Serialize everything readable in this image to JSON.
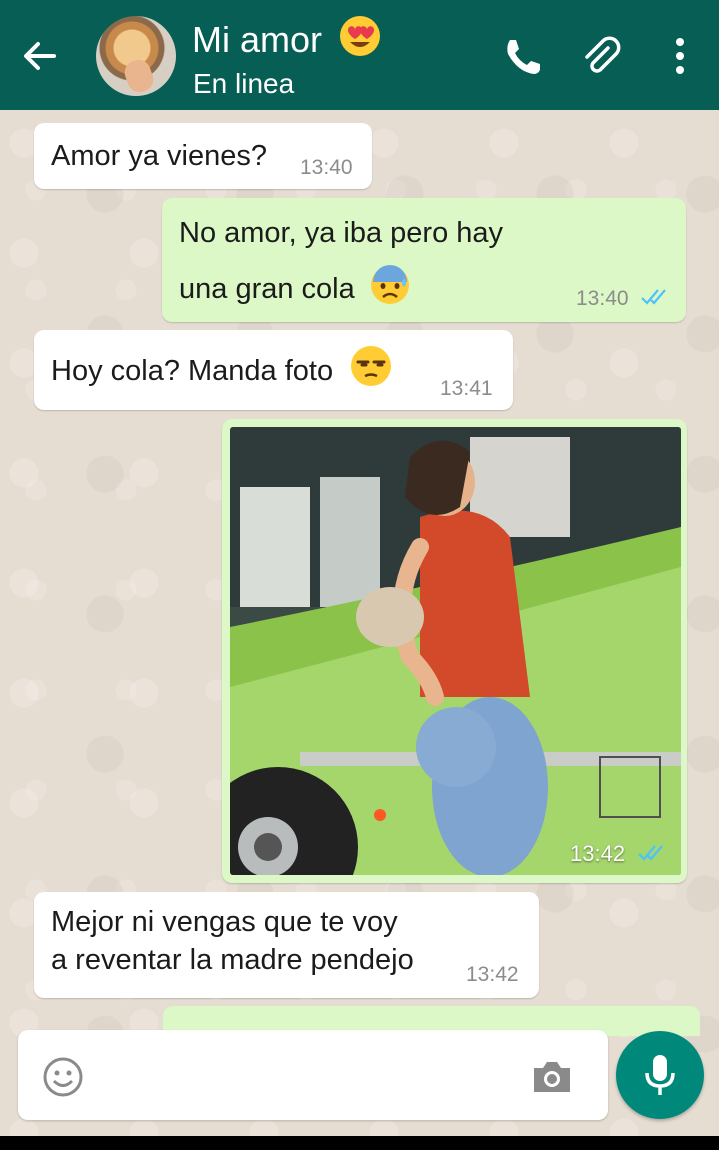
{
  "header": {
    "contact_name": "Mi amor",
    "status": "En linea",
    "emoji": "heart-eyes-emoji",
    "icons": [
      "back-arrow-icon",
      "phone-icon",
      "paperclip-icon",
      "more-vert-icon"
    ]
  },
  "messages": [
    {
      "direction": "incoming",
      "text": "Amor ya vienes?",
      "time": "13:40"
    },
    {
      "direction": "outgoing",
      "lines": [
        "No amor, ya iba pero hay",
        "una gran cola"
      ],
      "emoji": "anxious-sweat-emoji",
      "time": "13:40",
      "status": "read"
    },
    {
      "direction": "incoming",
      "text": "Hoy cola?  Manda foto",
      "emoji": "unamused-emoji",
      "time": "13:41"
    },
    {
      "direction": "outgoing",
      "type": "image",
      "time": "13:42",
      "status": "read"
    },
    {
      "direction": "incoming",
      "lines": [
        "Mejor ni vengas que te voy",
        "a reventar la madre pendejo"
      ],
      "time": "13:42"
    }
  ],
  "composer": {
    "value": "",
    "icons": [
      "emoji-icon",
      "camera-icon",
      "mic-icon"
    ]
  },
  "colors": {
    "header": "#075e54",
    "outgoing_bubble": "#dcf8c6",
    "incoming_bubble": "#ffffff",
    "fab": "#00897b",
    "read_ticks": "#4fc3f7"
  }
}
